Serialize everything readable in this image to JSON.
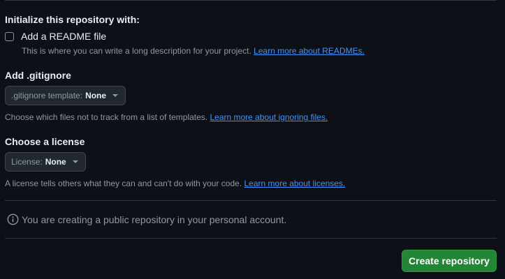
{
  "init": {
    "heading": "Initialize this repository with:",
    "readme_label": "Add a README file",
    "readme_checked": false,
    "readme_desc": "This is where you can write a long description for your project.",
    "readme_link": "Learn more about READMEs."
  },
  "gitignore": {
    "heading": "Add .gitignore",
    "select_label": ".gitignore template:",
    "select_value": "None",
    "desc": "Choose which files not to track from a list of templates.",
    "link": "Learn more about ignoring files."
  },
  "license": {
    "heading": "Choose a license",
    "select_label": "License:",
    "select_value": "None",
    "desc": "A license tells others what they can and can't do with your code.",
    "link": "Learn more about licenses."
  },
  "notice": {
    "icon": "info-icon",
    "text": "You are creating a public repository in your personal account."
  },
  "actions": {
    "create_label": "Create repository"
  },
  "colors": {
    "background": "#0d1117",
    "link": "#4493f8",
    "primary_button": "#238636"
  }
}
